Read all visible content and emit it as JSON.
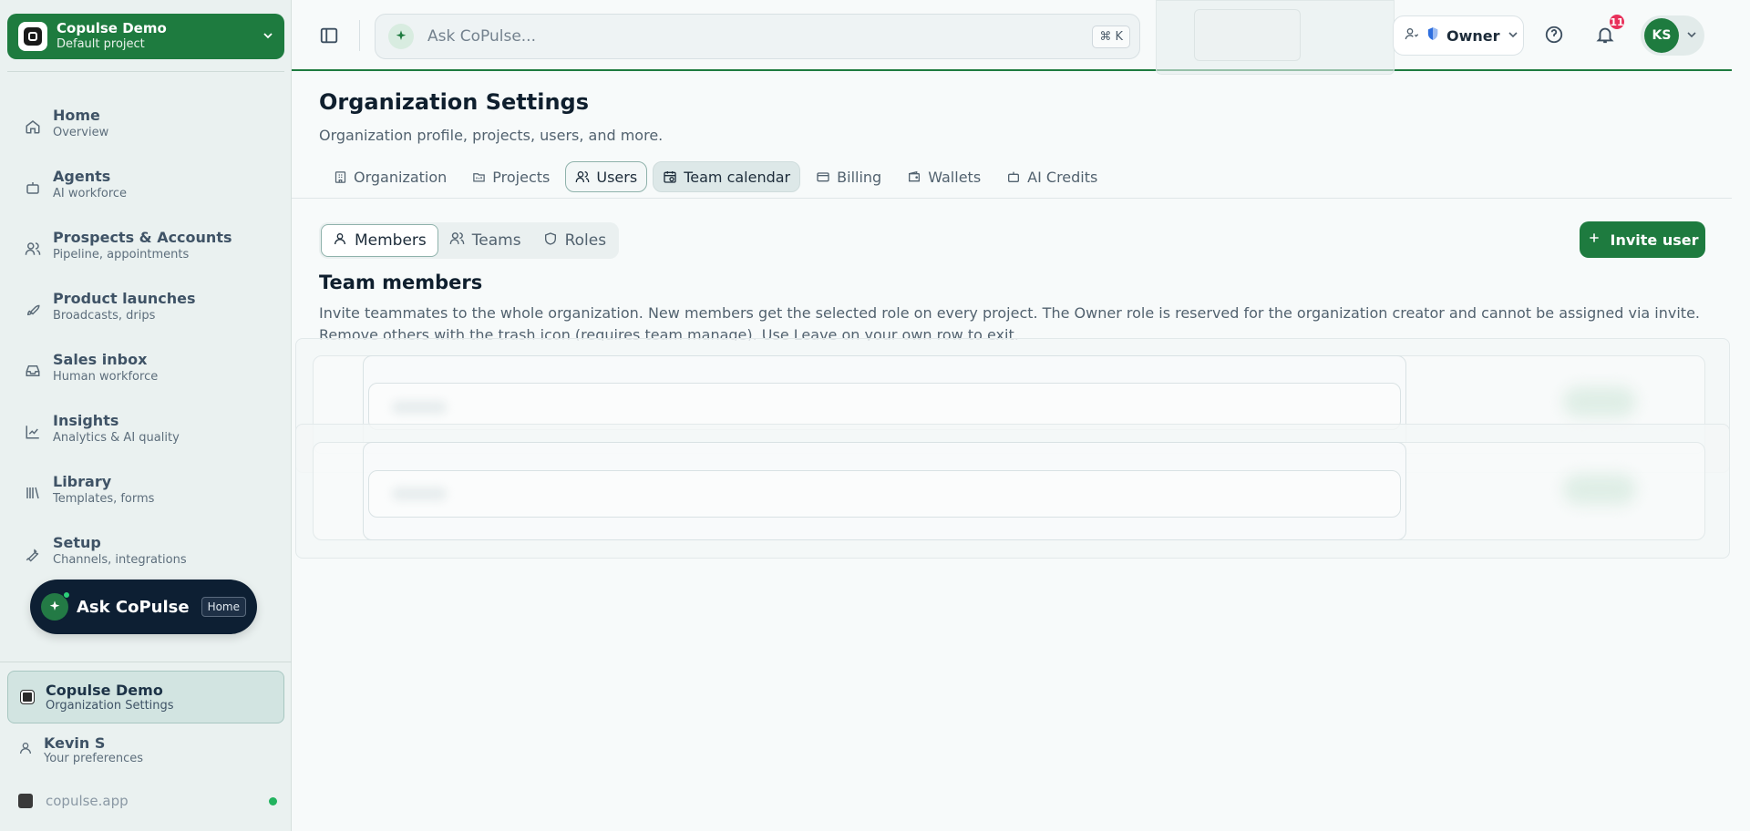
{
  "sidebar": {
    "project": {
      "name": "Copulse Demo",
      "sub": "Default project"
    },
    "nav": [
      {
        "label": "Home",
        "sub": "Overview",
        "icon": "home-icon"
      },
      {
        "label": "Agents",
        "sub": "AI workforce",
        "icon": "bot-icon"
      },
      {
        "label": "Prospects & Accounts",
        "sub": "Pipeline, appointments",
        "icon": "users-icon"
      },
      {
        "label": "Product launches",
        "sub": "Broadcasts, drips",
        "icon": "rocket-icon"
      },
      {
        "label": "Sales inbox",
        "sub": "Human workforce",
        "icon": "inbox-icon"
      },
      {
        "label": "Insights",
        "sub": "Analytics & AI quality",
        "icon": "chart-line-icon"
      },
      {
        "label": "Library",
        "sub": "Templates, forms",
        "icon": "library-icon"
      },
      {
        "label": "Setup",
        "sub": "Channels, integrations",
        "icon": "wrench-icon"
      }
    ],
    "ask": {
      "label": "Ask CoPulse",
      "badge": "Home"
    },
    "org_card": {
      "name": "Copulse Demo",
      "sub": "Organization Settings"
    },
    "user": {
      "name": "Kevin S",
      "sub": "Your preferences"
    },
    "domain": "copulse.app"
  },
  "topbar": {
    "ask_placeholder": "Ask CoPulse...",
    "shortcut": "⌘ K",
    "role": "Owner",
    "notifications": "11",
    "avatar_initials": "KS"
  },
  "page": {
    "title": "Organization Settings",
    "subtitle": "Organization profile, projects, users, and more.",
    "tabs": [
      {
        "label": "Organization",
        "icon": "building-icon"
      },
      {
        "label": "Projects",
        "icon": "projects-icon"
      },
      {
        "label": "Users",
        "icon": "users-icon",
        "active": true
      },
      {
        "label": "Team calendar",
        "icon": "calendar-icon"
      },
      {
        "label": "Billing",
        "icon": "credit-card-icon"
      },
      {
        "label": "Wallets",
        "icon": "wallet-icon"
      },
      {
        "label": "AI Credits",
        "icon": "bot-icon"
      }
    ],
    "subtabs": [
      {
        "label": "Members",
        "icon": "user-icon",
        "active": true
      },
      {
        "label": "Teams",
        "icon": "users-icon"
      },
      {
        "label": "Roles",
        "icon": "shield-icon"
      }
    ],
    "invite_label": "Invite user",
    "section_title": "Team members",
    "section_desc": "Invite teammates to the whole organization. New members get the selected role on every project. The Owner role is reserved for the organization creator and cannot be assigned via invite. Remove others with the trash icon (requires team manage). Use Leave on your own row to exit."
  },
  "colors": {
    "brand_green": "#1e7b3f",
    "sidebar_bg": "#eaf1f0",
    "badge_red": "#e8305a",
    "dark_pill": "#0d1f33"
  }
}
